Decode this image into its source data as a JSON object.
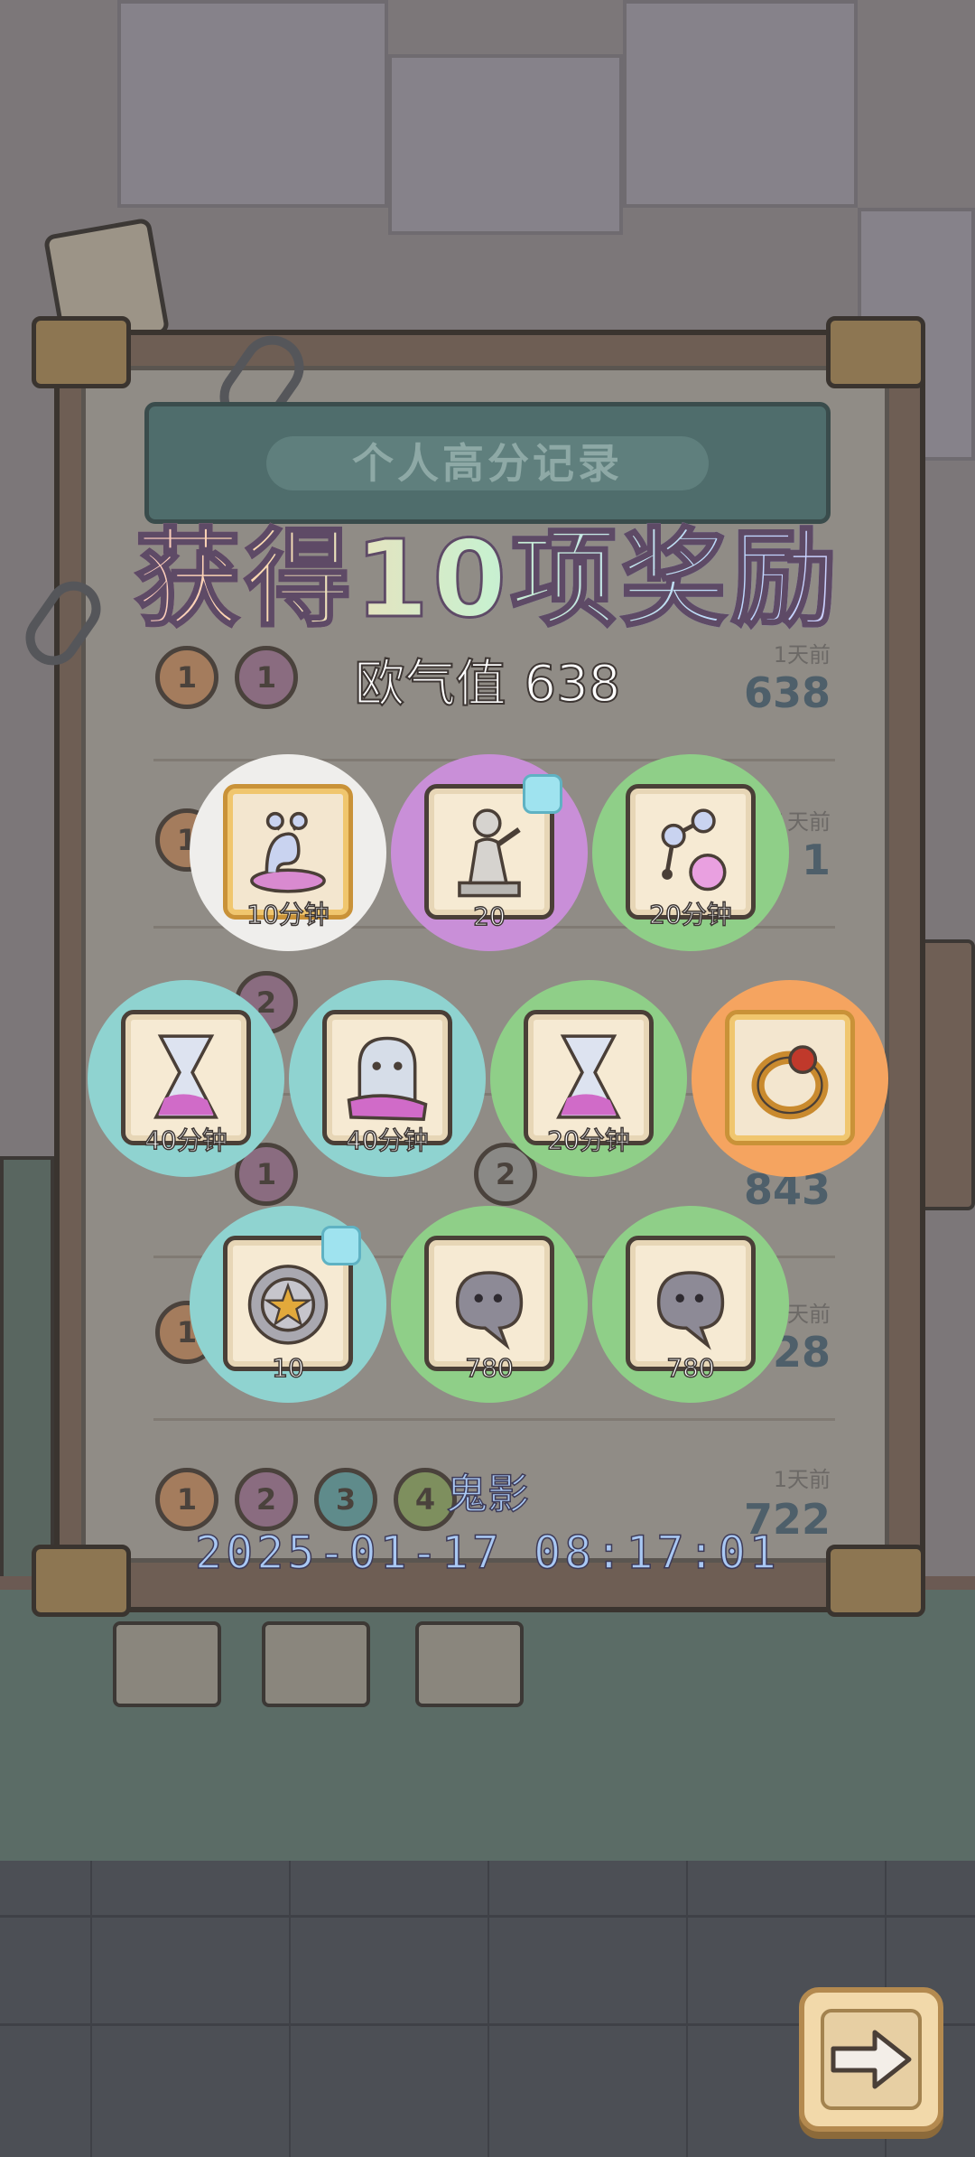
{
  "board": {
    "header_title": "个人高分记录",
    "rows": [
      {
        "time": "1天前",
        "score": "638"
      },
      {
        "time": "1天前",
        "score": "1"
      },
      {
        "time": "",
        "score": "843"
      },
      {
        "time": "1天前",
        "score": "28"
      },
      {
        "time": "1天前",
        "score": "722"
      }
    ]
  },
  "reward_popup": {
    "title": "获得10项奖励",
    "luck_label": "欧气值",
    "luck_value": "638",
    "items": [
      {
        "icon": "slug-potion-icon",
        "qty": "10分钟",
        "circle": "#efeeec",
        "frame": "gold"
      },
      {
        "icon": "statue-puzzle-icon",
        "qty": "20",
        "circle": "#c98fd8",
        "frame": "normal"
      },
      {
        "icon": "molecule-flask-icon",
        "qty": "20分钟",
        "circle": "#8fcf88",
        "frame": "normal"
      },
      {
        "icon": "hourglass-potion-icon",
        "qty": "40分钟",
        "circle": "#8fd3d0",
        "frame": "normal"
      },
      {
        "icon": "ghost-icon",
        "qty": "40分钟",
        "circle": "#8fd3d0",
        "frame": "normal"
      },
      {
        "icon": "hourglass-potion-icon",
        "qty": "20分钟",
        "circle": "#8fcf88",
        "frame": "normal"
      },
      {
        "icon": "gold-ring-icon",
        "qty": "",
        "circle": "#f5a460",
        "frame": "gold"
      },
      {
        "icon": "pentagram-compass-icon",
        "qty": "10",
        "circle": "#8fd3d0",
        "frame": "normal"
      },
      {
        "icon": "ghost-blob-icon",
        "qty": "780",
        "circle": "#8fcf88",
        "frame": "normal"
      },
      {
        "icon": "ghost-blob-icon",
        "qty": "780",
        "circle": "#8fcf88",
        "frame": "normal"
      }
    ],
    "player_name": "鬼影",
    "timestamp": "2025-01-17  08:17:01"
  },
  "next_button": {
    "icon": "arrow-right-icon"
  }
}
